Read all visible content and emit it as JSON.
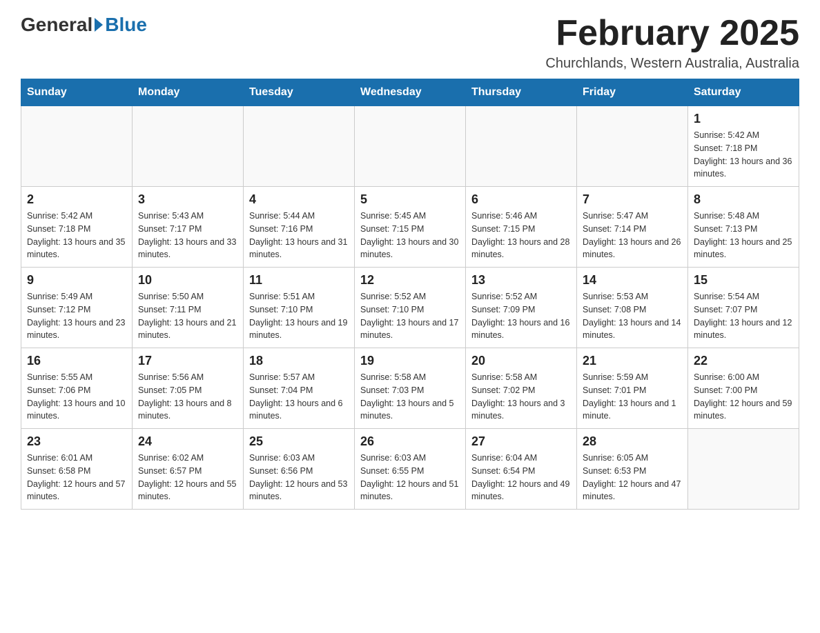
{
  "header": {
    "logo_general": "General",
    "logo_blue": "Blue",
    "month_title": "February 2025",
    "subtitle": "Churchlands, Western Australia, Australia"
  },
  "days_of_week": [
    "Sunday",
    "Monday",
    "Tuesday",
    "Wednesday",
    "Thursday",
    "Friday",
    "Saturday"
  ],
  "weeks": [
    [
      {
        "day": "",
        "info": ""
      },
      {
        "day": "",
        "info": ""
      },
      {
        "day": "",
        "info": ""
      },
      {
        "day": "",
        "info": ""
      },
      {
        "day": "",
        "info": ""
      },
      {
        "day": "",
        "info": ""
      },
      {
        "day": "1",
        "info": "Sunrise: 5:42 AM\nSunset: 7:18 PM\nDaylight: 13 hours and 36 minutes."
      }
    ],
    [
      {
        "day": "2",
        "info": "Sunrise: 5:42 AM\nSunset: 7:18 PM\nDaylight: 13 hours and 35 minutes."
      },
      {
        "day": "3",
        "info": "Sunrise: 5:43 AM\nSunset: 7:17 PM\nDaylight: 13 hours and 33 minutes."
      },
      {
        "day": "4",
        "info": "Sunrise: 5:44 AM\nSunset: 7:16 PM\nDaylight: 13 hours and 31 minutes."
      },
      {
        "day": "5",
        "info": "Sunrise: 5:45 AM\nSunset: 7:15 PM\nDaylight: 13 hours and 30 minutes."
      },
      {
        "day": "6",
        "info": "Sunrise: 5:46 AM\nSunset: 7:15 PM\nDaylight: 13 hours and 28 minutes."
      },
      {
        "day": "7",
        "info": "Sunrise: 5:47 AM\nSunset: 7:14 PM\nDaylight: 13 hours and 26 minutes."
      },
      {
        "day": "8",
        "info": "Sunrise: 5:48 AM\nSunset: 7:13 PM\nDaylight: 13 hours and 25 minutes."
      }
    ],
    [
      {
        "day": "9",
        "info": "Sunrise: 5:49 AM\nSunset: 7:12 PM\nDaylight: 13 hours and 23 minutes."
      },
      {
        "day": "10",
        "info": "Sunrise: 5:50 AM\nSunset: 7:11 PM\nDaylight: 13 hours and 21 minutes."
      },
      {
        "day": "11",
        "info": "Sunrise: 5:51 AM\nSunset: 7:10 PM\nDaylight: 13 hours and 19 minutes."
      },
      {
        "day": "12",
        "info": "Sunrise: 5:52 AM\nSunset: 7:10 PM\nDaylight: 13 hours and 17 minutes."
      },
      {
        "day": "13",
        "info": "Sunrise: 5:52 AM\nSunset: 7:09 PM\nDaylight: 13 hours and 16 minutes."
      },
      {
        "day": "14",
        "info": "Sunrise: 5:53 AM\nSunset: 7:08 PM\nDaylight: 13 hours and 14 minutes."
      },
      {
        "day": "15",
        "info": "Sunrise: 5:54 AM\nSunset: 7:07 PM\nDaylight: 13 hours and 12 minutes."
      }
    ],
    [
      {
        "day": "16",
        "info": "Sunrise: 5:55 AM\nSunset: 7:06 PM\nDaylight: 13 hours and 10 minutes."
      },
      {
        "day": "17",
        "info": "Sunrise: 5:56 AM\nSunset: 7:05 PM\nDaylight: 13 hours and 8 minutes."
      },
      {
        "day": "18",
        "info": "Sunrise: 5:57 AM\nSunset: 7:04 PM\nDaylight: 13 hours and 6 minutes."
      },
      {
        "day": "19",
        "info": "Sunrise: 5:58 AM\nSunset: 7:03 PM\nDaylight: 13 hours and 5 minutes."
      },
      {
        "day": "20",
        "info": "Sunrise: 5:58 AM\nSunset: 7:02 PM\nDaylight: 13 hours and 3 minutes."
      },
      {
        "day": "21",
        "info": "Sunrise: 5:59 AM\nSunset: 7:01 PM\nDaylight: 13 hours and 1 minute."
      },
      {
        "day": "22",
        "info": "Sunrise: 6:00 AM\nSunset: 7:00 PM\nDaylight: 12 hours and 59 minutes."
      }
    ],
    [
      {
        "day": "23",
        "info": "Sunrise: 6:01 AM\nSunset: 6:58 PM\nDaylight: 12 hours and 57 minutes."
      },
      {
        "day": "24",
        "info": "Sunrise: 6:02 AM\nSunset: 6:57 PM\nDaylight: 12 hours and 55 minutes."
      },
      {
        "day": "25",
        "info": "Sunrise: 6:03 AM\nSunset: 6:56 PM\nDaylight: 12 hours and 53 minutes."
      },
      {
        "day": "26",
        "info": "Sunrise: 6:03 AM\nSunset: 6:55 PM\nDaylight: 12 hours and 51 minutes."
      },
      {
        "day": "27",
        "info": "Sunrise: 6:04 AM\nSunset: 6:54 PM\nDaylight: 12 hours and 49 minutes."
      },
      {
        "day": "28",
        "info": "Sunrise: 6:05 AM\nSunset: 6:53 PM\nDaylight: 12 hours and 47 minutes."
      },
      {
        "day": "",
        "info": ""
      }
    ]
  ]
}
